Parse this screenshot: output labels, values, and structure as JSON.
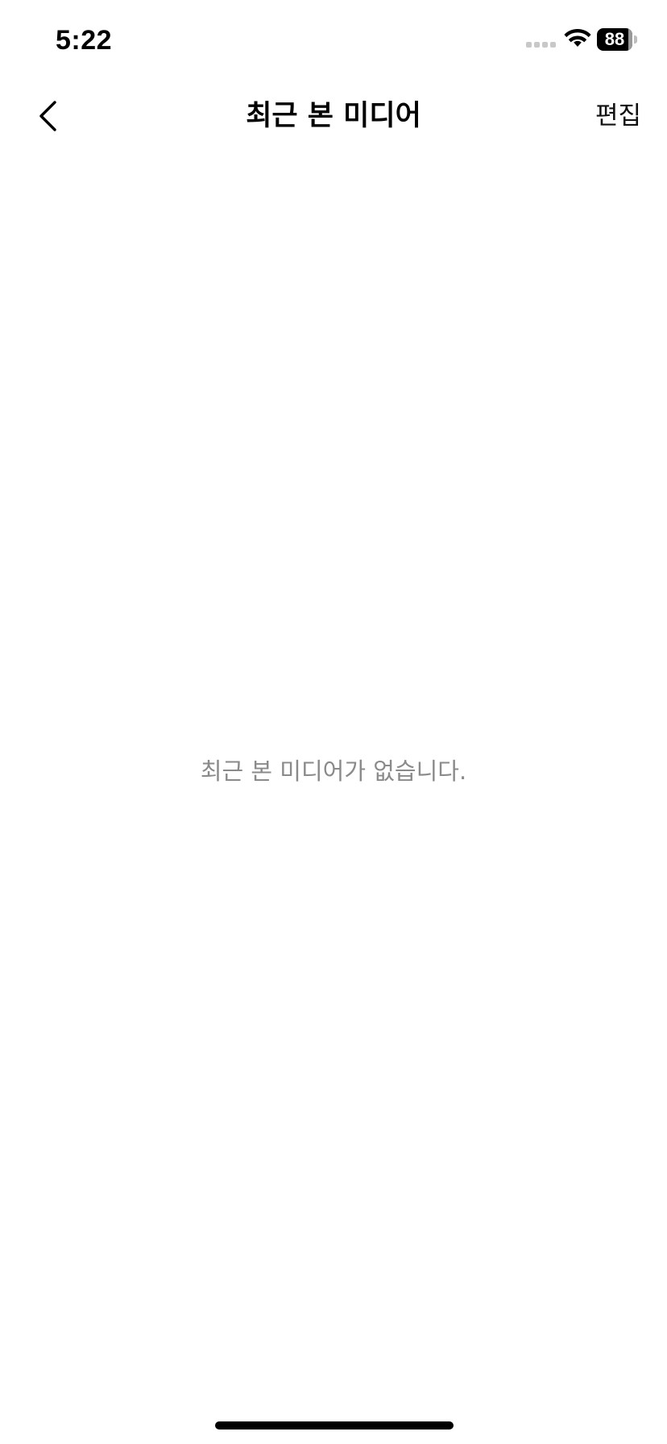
{
  "status_bar": {
    "time": "5:22",
    "battery_percent": "88",
    "battery_level": 0.88
  },
  "nav": {
    "title": "최근 본 미디어",
    "edit_label": "편집",
    "back_icon": "chevron-left-icon"
  },
  "empty_state": {
    "message": "최근 본 미디어가 없습니다."
  },
  "colors": {
    "background": "#ffffff",
    "text_primary": "#000000",
    "text_secondary": "#8a8a8a"
  }
}
